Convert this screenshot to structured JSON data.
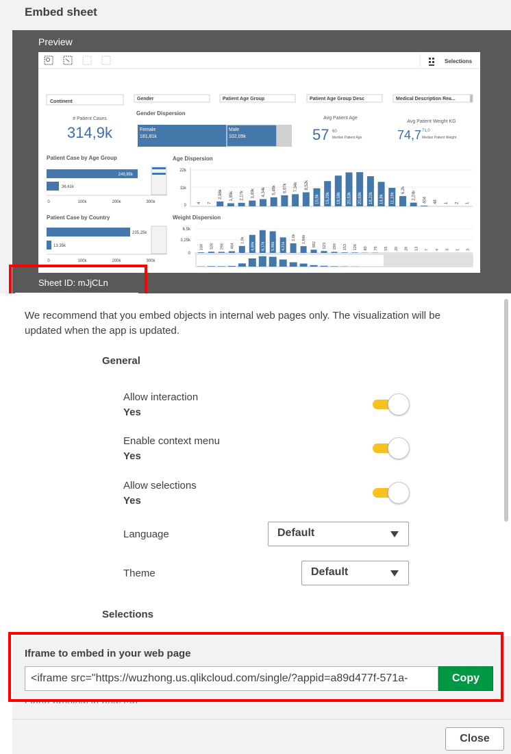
{
  "dialog": {
    "title": "Embed sheet"
  },
  "preview": {
    "label": "Preview",
    "sheet_id": "Sheet ID: mJjCLn",
    "toolbar": {
      "selections_label": "Selections"
    },
    "filters": [
      "Continent",
      "Gender",
      "Patient Age Group",
      "Patient Age Group Desc",
      "Medical Description Rea..."
    ],
    "kpi_patient_cases": {
      "label": "# Patient Cases",
      "value": "314,9k"
    },
    "gender_dispersion": {
      "title": "Gender Dispersion",
      "female_label": "Female",
      "female_value": "181,81k",
      "male_label": "Male",
      "male_value": "102,09k"
    },
    "avg_age": {
      "label": "Avg Patient Age",
      "value": "57",
      "small": "60",
      "sub": "Median Patient Age"
    },
    "avg_weight": {
      "label": "Avg Patient Weight KG",
      "value": "74,7",
      "small": "71,0",
      "sub": "Median Patient Weight"
    },
    "case_by_age_group": {
      "title": "Patient Case by Age Group",
      "bar1": "249,85k",
      "bar2": "36,61k",
      "ticks": [
        "0",
        "100k",
        "200k",
        "300k"
      ]
    },
    "case_by_country": {
      "title": "Patient Case by Country",
      "bar1": "235,25k",
      "bar2": "13,35k",
      "ticks": [
        "0",
        "100k",
        "200k",
        "300k"
      ]
    },
    "age_dispersion": {
      "title": "Age Dispersion",
      "yticks": [
        "22k",
        "11k",
        "0"
      ],
      "labels": [
        "4",
        "7",
        "2,96k",
        "1,85k",
        "2,17k",
        "3,49k",
        "4,34k",
        "5,46k",
        "6,67k",
        "7,34k",
        "8,52k",
        "10,9k",
        "15,29k",
        "18,58k",
        "20,53k",
        "20,69k",
        "18,22k",
        "14,8k",
        "11,19k",
        "6,2k",
        "2,24k",
        "404",
        "48",
        "1",
        "2",
        "1"
      ]
    },
    "weight_dispersion": {
      "title": "Weight Dispersion",
      "yticks": [
        "6,5k",
        "3,25k",
        "0"
      ],
      "labels": [
        "160",
        "328",
        "298",
        "464",
        "1,9k",
        "4,89k",
        "6,17k",
        "5,86k",
        "4,21k",
        "2,6k",
        "1,84k",
        "882",
        "523",
        "290",
        "153",
        "126",
        "80",
        "76",
        "55",
        "20",
        "20",
        "13",
        "7",
        "4",
        "3",
        "1",
        "3"
      ]
    }
  },
  "notice": "We recommend that you embed objects in internal web pages only. The visualization will be updated when the app is updated.",
  "general": {
    "title": "General",
    "allow_interaction": {
      "label": "Allow interaction",
      "value": "Yes"
    },
    "enable_context_menu": {
      "label": "Enable context menu",
      "value": "Yes"
    },
    "allow_selections": {
      "label": "Allow selections",
      "value": "Yes"
    },
    "language": {
      "label": "Language",
      "value": "Default"
    },
    "theme": {
      "label": "Theme",
      "value": "Default"
    }
  },
  "selections": {
    "title": "Selections"
  },
  "iframe": {
    "title": "Iframe to embed in your web page",
    "code": "<iframe src=\"https://wuzhong.us.qlikcloud.com/single/?appid=a89d477f-571a-",
    "copy_label": "Copy",
    "open_preview_label": "Open preview in new tab"
  },
  "footer": {
    "close_label": "Close"
  },
  "colors": {
    "accent_toggle": "#f7c21f",
    "copy_green": "#009845",
    "bar_blue": "#4477aa",
    "highlight_red": "#ff0000"
  }
}
